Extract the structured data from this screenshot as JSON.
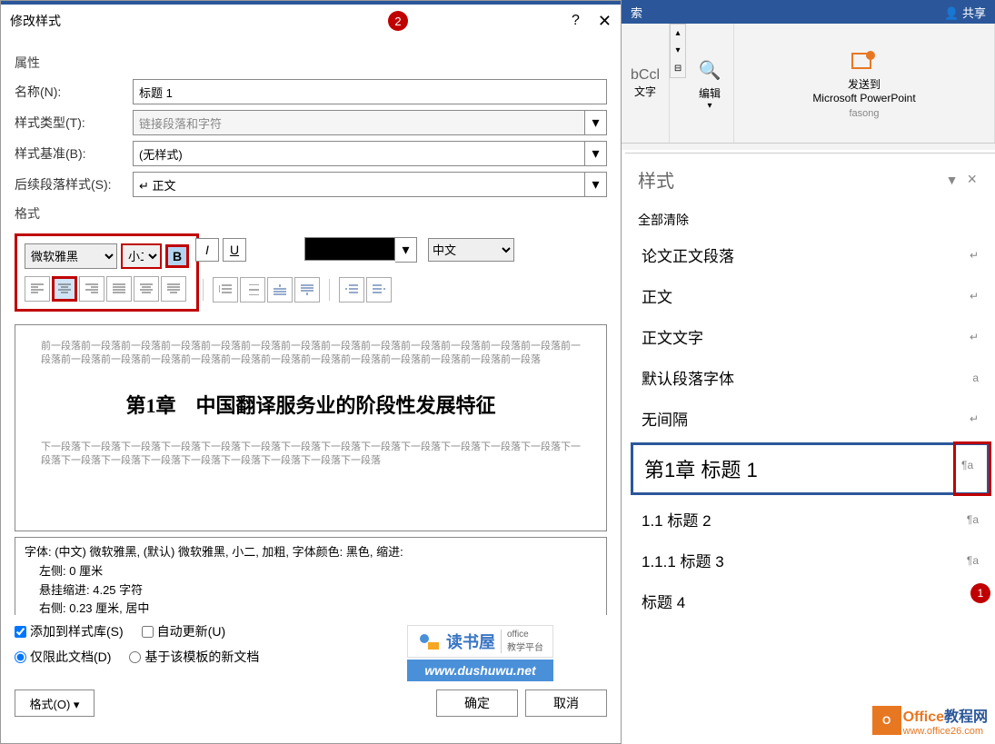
{
  "dialog": {
    "title": "修改样式",
    "badge": "2",
    "help": "?",
    "close": "✕",
    "section_props": "属性",
    "name_label": "名称(N):",
    "name_value": "标题 1",
    "type_label": "样式类型(T):",
    "type_value": "链接段落和字符",
    "base_label": "样式基准(B):",
    "base_value": "(无样式)",
    "next_label": "后续段落样式(S):",
    "next_value": "↵ 正文",
    "section_format": "格式",
    "font": "微软雅黑",
    "size": "小二",
    "lang": "中文",
    "preview_prev": "前一段落前一段落前一段落前一段落前一段落前一段落前一段落前一段落前一段落前一段落前一段落前一段落前一段落前一段落前一段落前一段落前一段落前一段落前一段落前一段落前一段落前一段落前一段落前一段落前一段落前一段落",
    "preview_heading": "第1章　中国翻译服务业的阶段性发展特征",
    "preview_next": "下一段落下一段落下一段落下一段落下一段落下一段落下一段落下一段落下一段落下一段落下一段落下一段落下一段落下一段落下一段落下一段落下一段落下一段落下一段落下一段落下一段落下一段落",
    "desc1": "字体: (中文) 微软雅黑, (默认) 微软雅黑, 小二, 加粗, 字体颜色: 黑色, 缩进:",
    "desc2": "左侧: 0 厘米",
    "desc3": "悬挂缩进: 4.25 字符",
    "desc4": "右侧: 0.23 厘米, 居中",
    "add_quick": "添加到样式库(S)",
    "auto_update": "自动更新(U)",
    "only_doc": "仅限此文档(D)",
    "based_template": "基于该模板的新文档",
    "format_menu": "格式(O) ▾",
    "ok": "确定",
    "cancel": "取消"
  },
  "ribbon": {
    "toptext": "索",
    "share": "共享",
    "abccl": "bCcl",
    "styletxt": "文字",
    "edit": "编辑",
    "sendto": "发送到",
    "sendto2": "Microsoft PowerPoint",
    "fasong": "fasong"
  },
  "styles": {
    "header": "样式",
    "clear_all": "全部清除",
    "items": [
      {
        "label": "论文正文段落",
        "marker": "↵"
      },
      {
        "label": "正文",
        "marker": "↵"
      },
      {
        "label": "正文文字",
        "marker": "↵"
      },
      {
        "label": "默认段落字体",
        "marker": "a"
      },
      {
        "label": "无间隔",
        "marker": "↵"
      },
      {
        "label": "第1章 标题 1",
        "marker": "¶a"
      },
      {
        "label": "1.1 标题 2",
        "marker": "¶a"
      },
      {
        "label": "1.1.1 标题 3",
        "marker": "¶a"
      },
      {
        "label": "标题 4",
        "marker": ""
      }
    ],
    "badge": "1"
  },
  "watermark1": {
    "text": "读书屋",
    "sub1": "office",
    "sub2": "教学平台",
    "url": "www.dushuwu.net"
  },
  "watermark2": {
    "office": "Office",
    "suffix": "教程网",
    "url": "www.office26.com"
  }
}
